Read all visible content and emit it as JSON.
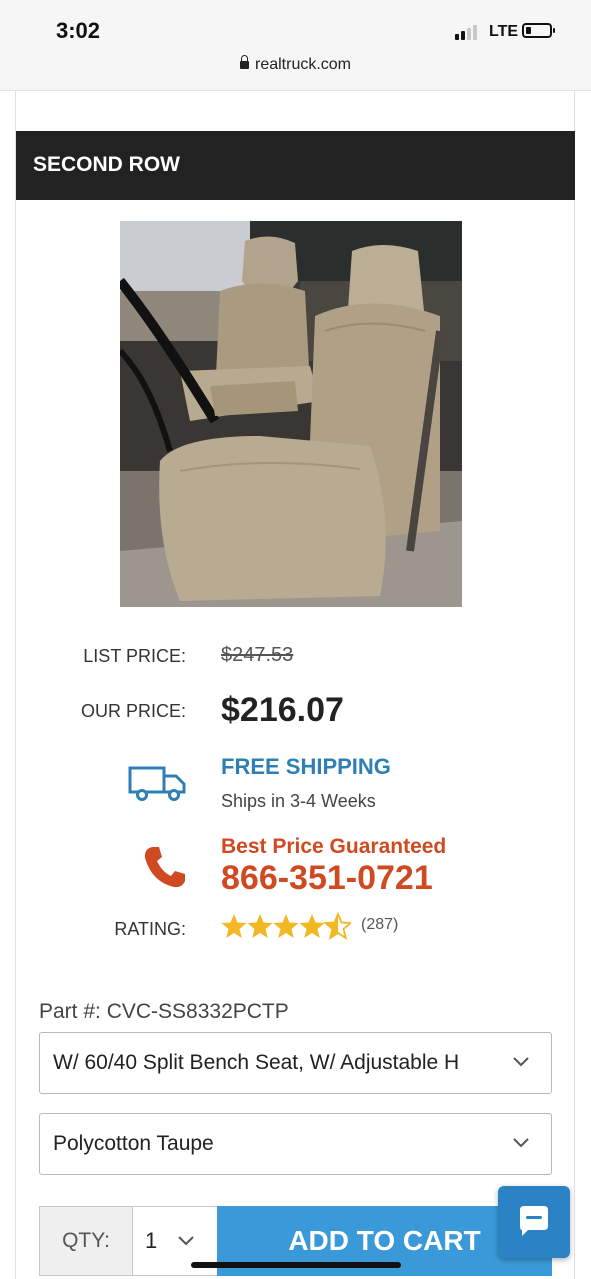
{
  "status_bar": {
    "time": "3:02",
    "network": "LTE",
    "url": "realtruck.com"
  },
  "section": {
    "title": "SECOND ROW"
  },
  "pricing": {
    "list_price_label": "LIST PRICE:",
    "list_price": "$247.53",
    "our_price_label": "OUR PRICE:",
    "our_price": "$216.07"
  },
  "shipping": {
    "title": "FREE SHIPPING",
    "detail": "Ships in 3-4 Weeks",
    "icon": "truck-icon"
  },
  "guarantee": {
    "title": "Best Price Guaranteed",
    "phone": "866-351-0721",
    "icon": "phone-icon"
  },
  "rating": {
    "label": "RATING:",
    "stars": 4.5,
    "count": "(287)"
  },
  "product": {
    "part_number": "Part #: CVC-SS8332PCTP",
    "seat_option": "W/ 60/40 Split Bench Seat, W/ Adjustable H",
    "material_option": "Polycotton Taupe"
  },
  "cart": {
    "qty_label": "QTY:",
    "qty_value": "1",
    "add_label": "ADD TO CART"
  },
  "colors": {
    "header_bg": "#222222",
    "link_blue": "#2f7fb5",
    "accent_orange": "#d04a21",
    "star_gold": "#f2b823",
    "button_blue": "#3a9ad9"
  }
}
